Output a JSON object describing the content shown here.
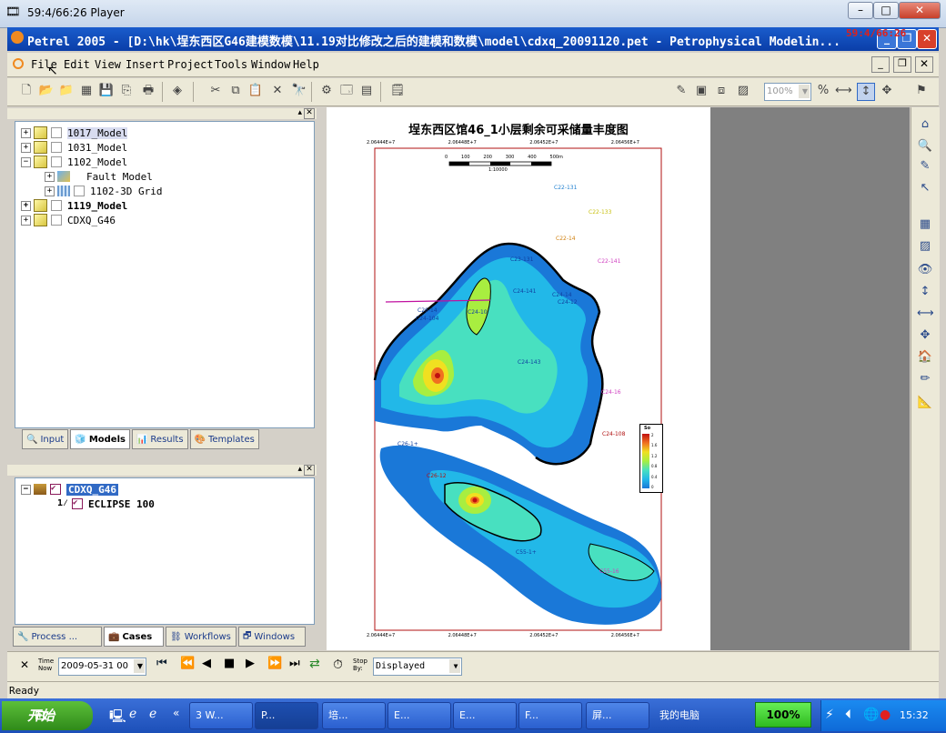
{
  "player": {
    "title": "59:4/66:26 Player",
    "rec_time": "59:4/66:26"
  },
  "window": {
    "title": "Petrel 2005 - [D:\\hk\\埕东西区G46建模数模\\11.19对比修改之后的建模和数模\\model\\cdxq_20091120.pet - Petrophysical Modelin..."
  },
  "menu": {
    "items": [
      "File",
      "Edit",
      "View",
      "Insert",
      "Project",
      "Tools",
      "Window",
      "Help"
    ]
  },
  "toolbar": {
    "zoom_value": "100%"
  },
  "models_tree": {
    "items": [
      {
        "label": "1017_Model"
      },
      {
        "label": "1031_Model"
      },
      {
        "label": "1102_Model"
      },
      {
        "label": "Fault Model"
      },
      {
        "label": "1102-3D Grid"
      },
      {
        "label": "1119_Model"
      },
      {
        "label": "CDXQ_G46"
      }
    ]
  },
  "top_tabs": [
    "Input",
    "Models",
    "Results",
    "Templates"
  ],
  "cases_tree": {
    "items": [
      {
        "label": "CDXQ_G46"
      },
      {
        "label": "ECLIPSE 100"
      }
    ]
  },
  "bottom_tabs": [
    "Process ...",
    "Cases",
    "Workflows",
    "Windows"
  ],
  "map": {
    "title": "埕东西区馆46_1小层剩余可采储量丰度图",
    "scale_ticks": [
      "0",
      "100",
      "200",
      "300",
      "400",
      "500m"
    ],
    "scale_label": "1:10000",
    "top_axis": [
      "2.06444E+7",
      "2.06448E+7",
      "2.06452E+7",
      "2.06456E+7"
    ],
    "bottom_axis": [
      "2.06444E+7",
      "2.06448E+7",
      "2.06452E+7",
      "2.06456E+7"
    ],
    "wells": [
      "C22-131",
      "C22-133",
      "C22-14",
      "C22-141",
      "C23-131",
      "C24-141",
      "C24-14",
      "C24-12",
      "C26-14",
      "C24-10",
      "C24-104",
      "C24-143",
      "C24-16",
      "C24-108",
      "C26-1+",
      "C55-1+",
      "C55-16",
      "C26-12"
    ],
    "legend": {
      "title": "So",
      "ticks": [
        "2",
        "1.6",
        "1.2",
        "0.8",
        "0.4",
        "0"
      ]
    }
  },
  "player_controls": {
    "time_label": "Time\nNow",
    "time_value": "2009-05-31 00",
    "stop_label": "Stop\nBy:",
    "stop_value": "Displayed"
  },
  "status": "Ready",
  "taskbar": {
    "start": "开始",
    "tasks": [
      "3 W...",
      "P...",
      "培...",
      "E...",
      "E...",
      "F...",
      "屏...",
      "我的电脑"
    ],
    "zoom": "100%",
    "clock": "15:32"
  }
}
